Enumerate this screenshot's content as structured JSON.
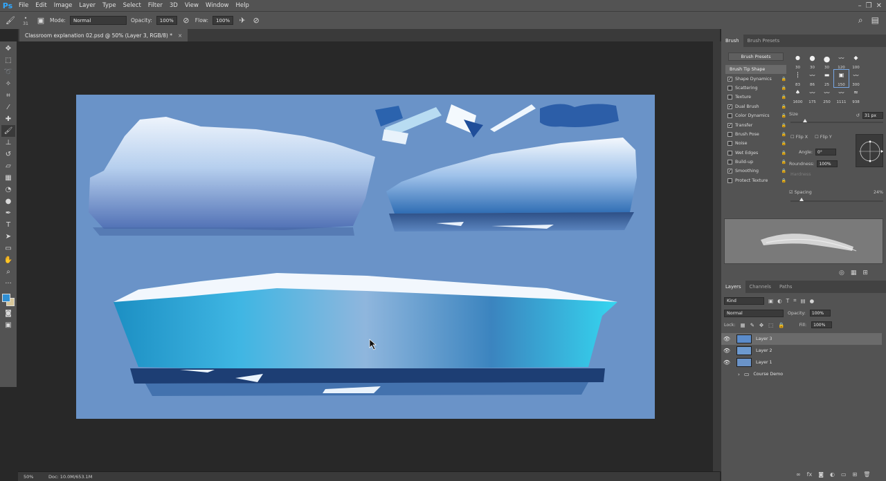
{
  "app": {
    "logo": "Ps"
  },
  "menu": [
    "File",
    "Edit",
    "Image",
    "Layer",
    "Type",
    "Select",
    "Filter",
    "3D",
    "View",
    "Window",
    "Help"
  ],
  "options": {
    "brush_size": "31",
    "mode_label": "Mode:",
    "mode_value": "Normal",
    "opacity_label": "Opacity:",
    "opacity_value": "100%",
    "flow_label": "Flow:",
    "flow_value": "100%"
  },
  "document": {
    "tab_title": "Classroom explanation 02.psd @ 50% (Layer 3, RGB/8) *",
    "close": "×"
  },
  "status": {
    "zoom": "50%",
    "doc_size": "Doc: 10.0M/653.1M"
  },
  "colors": {
    "canvas_bg": "#6a93c8",
    "foreground": "#2f8fd3",
    "background": "#d8c79a"
  },
  "brush_panel": {
    "tabs": [
      "Brush",
      "Brush Presets"
    ],
    "presets_button": "Brush Presets",
    "options": [
      {
        "label": "Brush Tip Shape",
        "checked": null,
        "header": true
      },
      {
        "label": "Shape Dynamics",
        "checked": true
      },
      {
        "label": "Scattering",
        "checked": false
      },
      {
        "label": "Texture",
        "checked": false
      },
      {
        "label": "Dual Brush",
        "checked": true
      },
      {
        "label": "Color Dynamics",
        "checked": false
      },
      {
        "label": "Transfer",
        "checked": true
      },
      {
        "label": "Brush Pose",
        "checked": false
      },
      {
        "label": "Noise",
        "checked": false
      },
      {
        "label": "Wet Edges",
        "checked": false
      },
      {
        "label": "Build-up",
        "checked": false
      },
      {
        "label": "Smoothing",
        "checked": true
      },
      {
        "label": "Protect Texture",
        "checked": false
      }
    ],
    "tips": [
      "30",
      "30",
      "30",
      "120",
      "100",
      "",
      "83",
      "86",
      "25",
      "150",
      "300",
      "",
      "1600",
      "175",
      "250",
      "1111",
      "938",
      ""
    ],
    "selected_tip": 9,
    "size_label": "Size",
    "size_value": "31 px",
    "flip_x": "Flip X",
    "flip_y": "Flip Y",
    "angle_label": "Angle:",
    "angle_value": "0°",
    "roundness_label": "Roundness:",
    "roundness_value": "100%",
    "hardness_label": "Hardness",
    "spacing_label": "Spacing",
    "spacing_value": "24%"
  },
  "layers_panel": {
    "tabs": [
      "Layers",
      "Channels",
      "Paths"
    ],
    "kind": "Kind",
    "blend_mode": "Normal",
    "opacity_label": "Opacity:",
    "opacity_value": "100%",
    "lock_label": "Lock:",
    "fill_label": "Fill:",
    "fill_value": "100%",
    "layers": [
      {
        "name": "Layer 3",
        "visible": true,
        "selected": true,
        "thumb": "#5b8ccb"
      },
      {
        "name": "Layer 2",
        "visible": true,
        "selected": false,
        "thumb": "#6d9ad0"
      },
      {
        "name": "Layer 1",
        "visible": true,
        "selected": false,
        "thumb": "#6a93c8"
      },
      {
        "name": "Course Demo",
        "visible": false,
        "selected": false,
        "thumb": "folder"
      }
    ],
    "footer_icons": [
      "link-icon",
      "fx-icon",
      "mask-icon",
      "adjustment-icon",
      "group-icon",
      "new-layer-icon",
      "trash-icon"
    ]
  }
}
